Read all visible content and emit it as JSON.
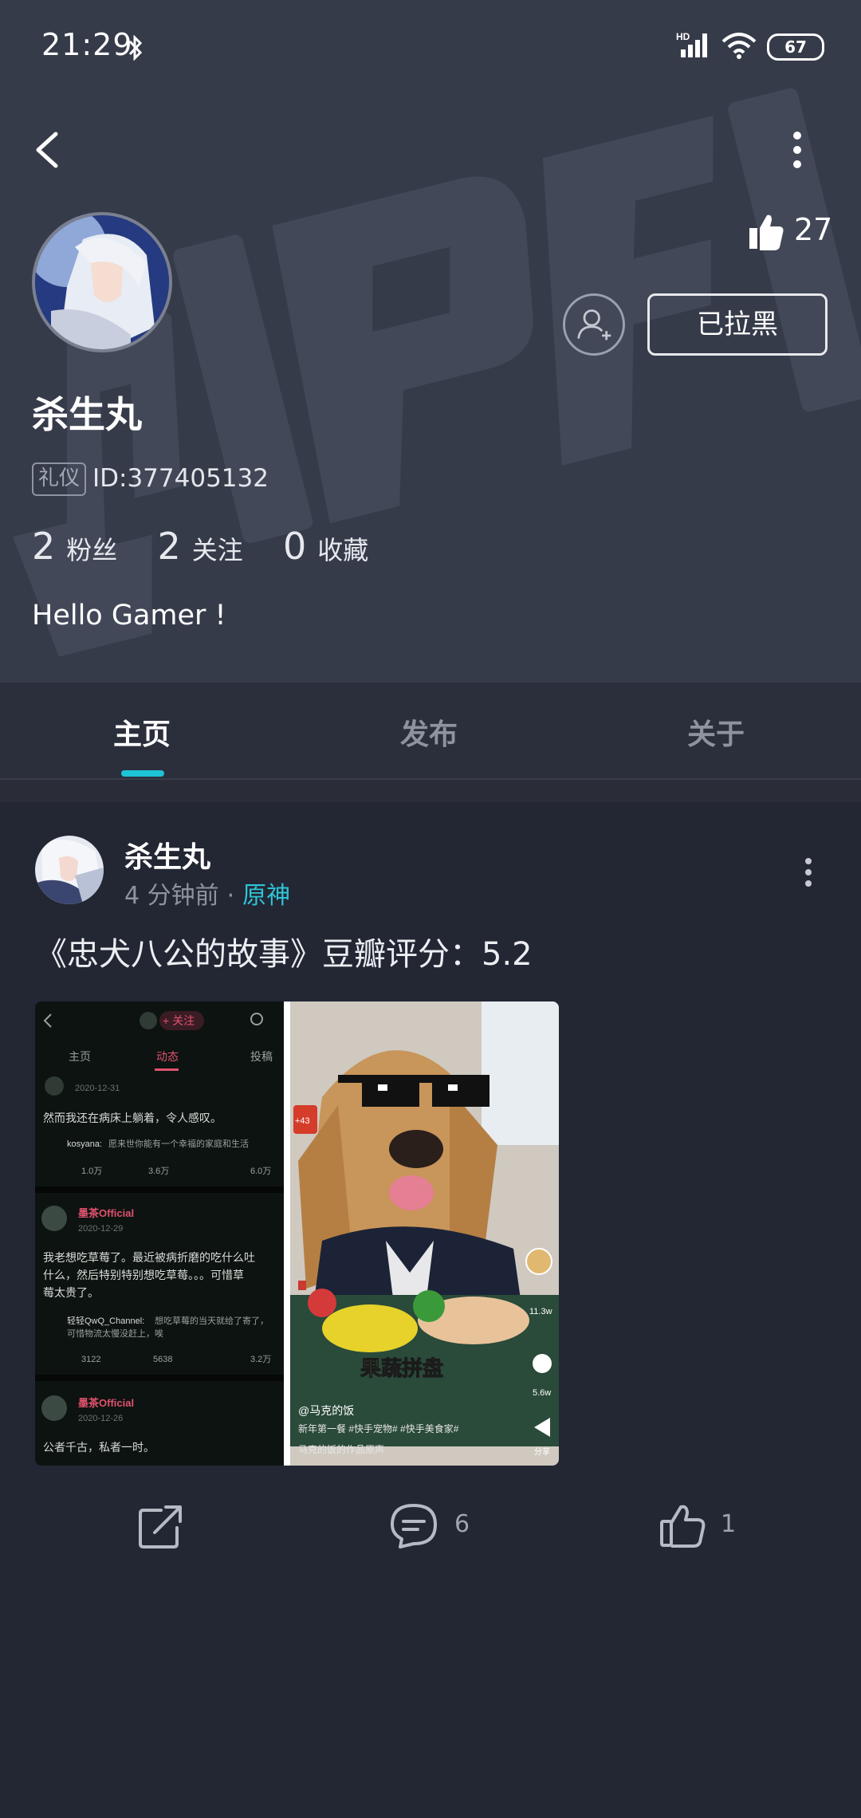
{
  "status_bar": {
    "time": "21:29",
    "battery": "67",
    "network": "HD"
  },
  "profile": {
    "likes": "27",
    "blocked_label": "已拉黑",
    "username": "杀生丸",
    "badge": "礼仪",
    "id_text": "ID:377405132",
    "stats": [
      {
        "num": "2",
        "label": "粉丝"
      },
      {
        "num": "2",
        "label": "关注"
      },
      {
        "num": "0",
        "label": "收藏"
      }
    ],
    "bio": "Hello Gamer !"
  },
  "tabs": [
    {
      "label": "主页",
      "active": true
    },
    {
      "label": "发布",
      "active": false
    },
    {
      "label": "关于",
      "active": false
    }
  ],
  "post": {
    "author": "杀生丸",
    "time_ago": "4 分钟前",
    "separator": "·",
    "game": "原神",
    "text": "《忠犬八公的故事》豆瓣评分：5.2",
    "comments": "6",
    "likes": "1",
    "image": {
      "left": {
        "follow": "+ 关注",
        "tabs": [
          "主页",
          "动态",
          "投稿"
        ],
        "post1_date": "2020-12-31",
        "post1_text": "然而我还在病床上躺着，令人感叹。",
        "post1_reply_user": "kosyana:",
        "post1_reply_text": "愿来世你能有一个幸福的家庭和生活",
        "post1_counts": [
          "1.0万",
          "3.6万",
          "6.0万"
        ],
        "post2_author": "墨茶Official",
        "post2_date": "2020-12-29",
        "post2_text_1": "我老想吃草莓了。最近被病折磨的吃什么吐",
        "post2_text_2": "什么，然后特别特别想吃草莓。。。可惜草",
        "post2_text_3": "莓太贵了。",
        "post2_reply_user": "轻轻QwQ_Channel:",
        "post2_reply_text_1": "想吃草莓的当天就给了寄了，",
        "post2_reply_text_2": "可惜物流太慢没赶上，唉",
        "post2_counts": [
          "3122",
          "5638",
          "3.2万"
        ],
        "post3_author": "墨茶Official",
        "post3_date": "2020-12-26",
        "post3_text": "公者千古，私者一时。"
      },
      "right": {
        "side_badge": "+43",
        "side_count_1": "11.3w",
        "side_count_2": "5.6w",
        "share_label": "分享",
        "banner": "果蔬拼盘",
        "account": "@马克的饭",
        "caption": "新年第一餐 #快手宠物# #快手美食家#",
        "music": "马克的饭的作品原声"
      }
    }
  },
  "colors": {
    "accent": "#1fc3d6",
    "header_bg": "#363b4a",
    "page_bg": "#232734"
  }
}
